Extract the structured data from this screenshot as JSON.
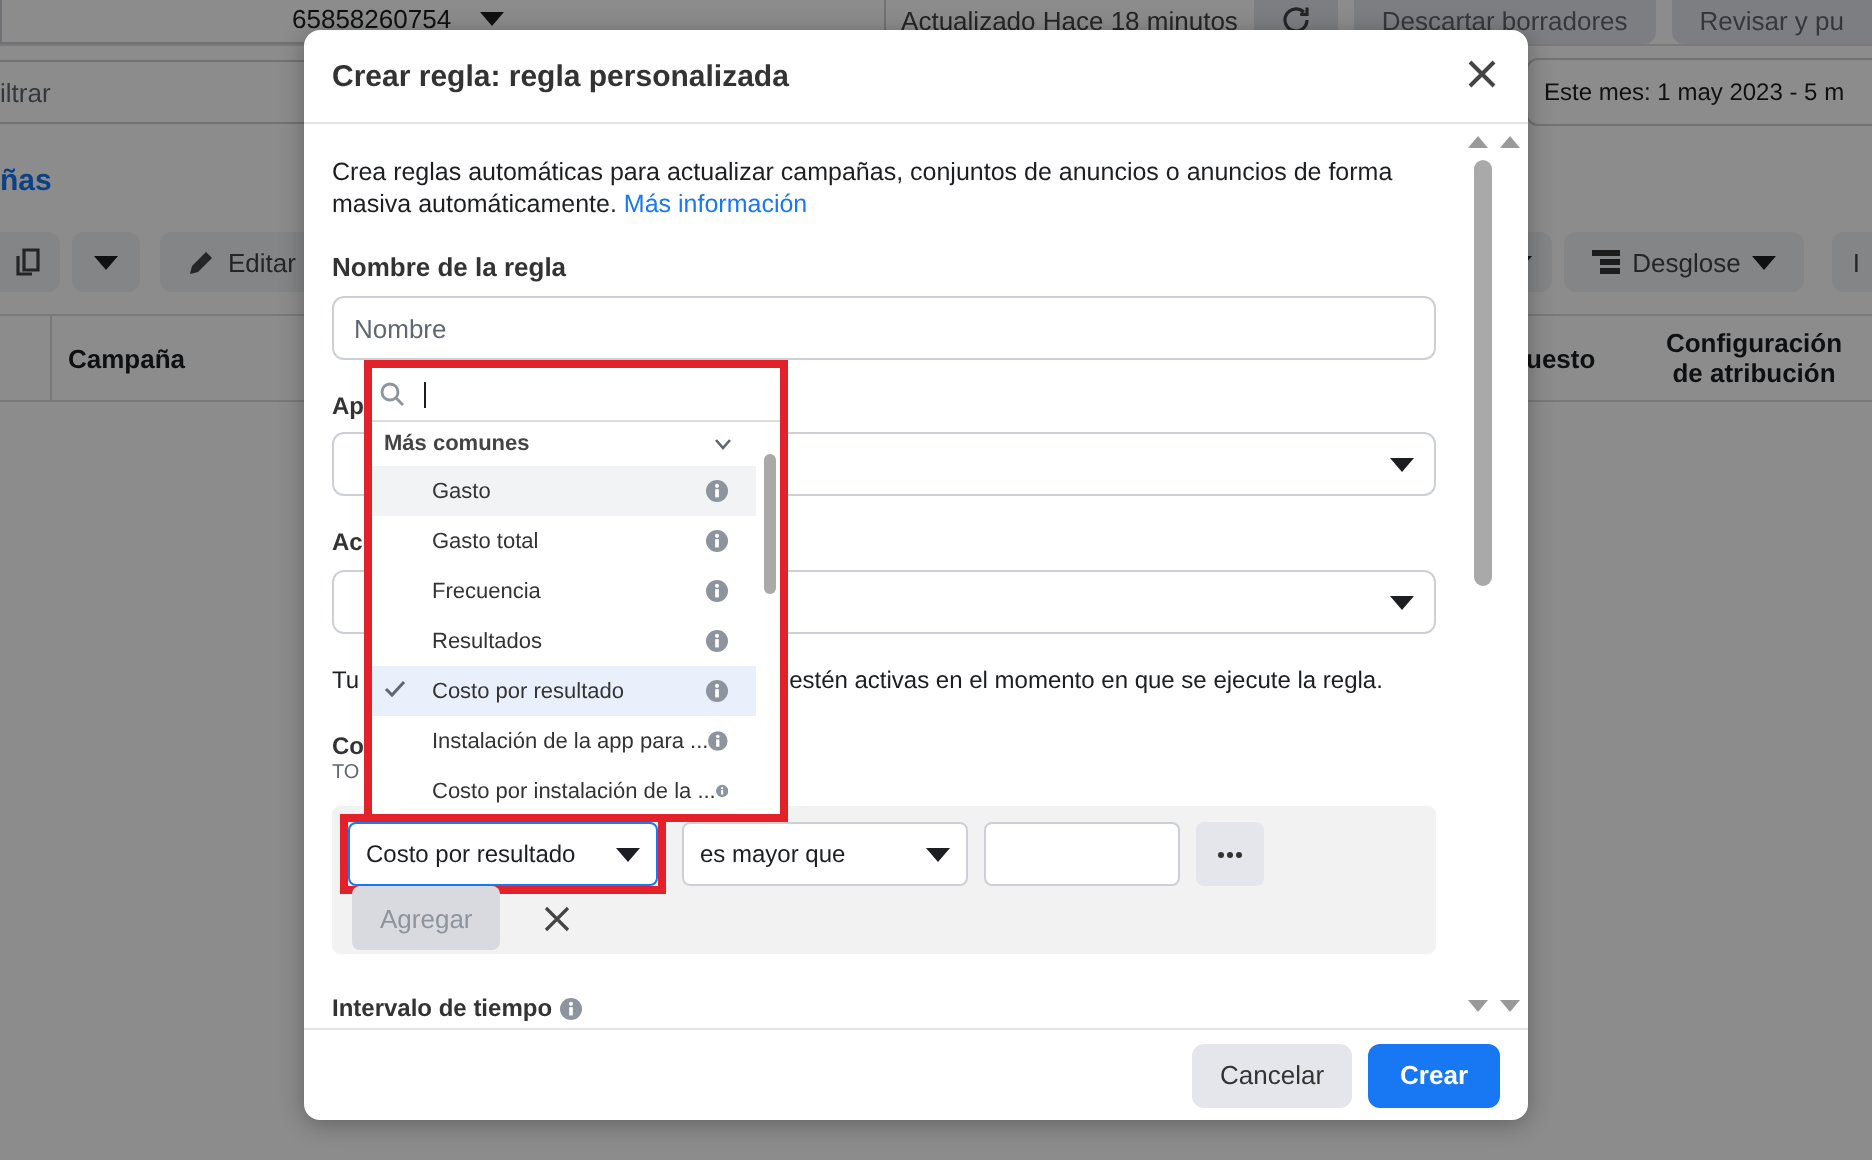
{
  "background": {
    "account": "65858260754",
    "updated": "Actualizado Hace 18 minutos",
    "discard_button": "Descartar borradores",
    "review_button": "Revisar y pu",
    "filter_placeholder": "iltrar",
    "date_range": "Este mes: 1 may 2023 - 5 m",
    "tab_link": "ñas",
    "edit_button": "Editar",
    "breakdown_button": "Desglose",
    "cut_button": "I",
    "columns": [
      "Campaña",
      "uesto",
      "Configuración de atribución"
    ]
  },
  "dialog": {
    "title": "Crear regla: regla personalizada",
    "intro": "Crea reglas automáticas para actualizar campañas, conjuntos de anuncios o anuncios de forma masiva automáticamente.",
    "intro_link": "Más información",
    "name_label": "Nombre de la regla",
    "name_placeholder": "Nombre",
    "apply_label": "Ap",
    "action_label": "Ac",
    "note_start": "Tu",
    "note_end": "estén activas en el momento en que se ejecute la regla.",
    "conditions_label": "Co",
    "conditions_sub": "TO",
    "condition": {
      "metric": "Costo por resultado",
      "operator": "es mayor que"
    },
    "add_button": {
      "label": "Agregar",
      "disabled": true
    },
    "time_label": "Intervalo de tiempo",
    "buttons": [
      {
        "label": "Cancelar",
        "kind": "secondary"
      },
      {
        "label": "Crear",
        "kind": "primary"
      }
    ]
  },
  "dropdown": {
    "group": "Más comunes",
    "expanded": true,
    "items": [
      {
        "label": "Gasto",
        "selected": false,
        "hovered": true
      },
      {
        "label": "Gasto total",
        "selected": false,
        "hovered": false
      },
      {
        "label": "Frecuencia",
        "selected": false,
        "hovered": false
      },
      {
        "label": "Resultados",
        "selected": false,
        "hovered": false
      },
      {
        "label": "Costo por resultado",
        "selected": true,
        "hovered": false
      },
      {
        "label": "Instalación de la app para ...",
        "selected": false,
        "hovered": false
      },
      {
        "label": "Costo por instalación de la ...",
        "selected": false,
        "hovered": false
      }
    ]
  }
}
